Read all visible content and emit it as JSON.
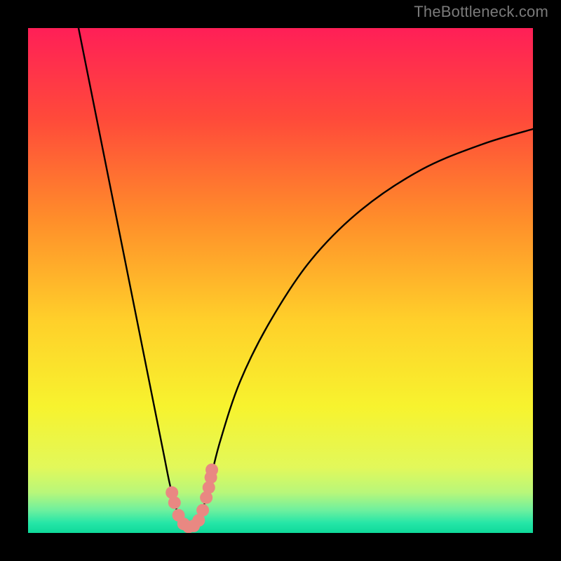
{
  "watermark": "TheBottleneck.com",
  "chart_data": {
    "type": "line",
    "title": "",
    "xlabel": "",
    "ylabel": "",
    "xlim": [
      0,
      100
    ],
    "ylim": [
      0,
      100
    ],
    "grid": false,
    "series": [
      {
        "name": "curve",
        "x": [
          10,
          14,
          18,
          20,
          22,
          24,
          25,
          26,
          27,
          28,
          29,
          30,
          31,
          32,
          33,
          34,
          35,
          36,
          38,
          42,
          48,
          56,
          66,
          78,
          90,
          100
        ],
        "values": [
          100,
          80,
          60,
          50,
          40,
          30,
          25,
          20,
          15,
          10,
          6,
          3,
          1.5,
          1,
          1.5,
          3,
          6,
          10,
          18,
          30,
          42,
          54,
          64,
          72,
          77,
          80
        ]
      }
    ],
    "markers": {
      "name": "highlight-points",
      "color": "#e98882",
      "x": [
        28.5,
        29,
        29.8,
        30.8,
        31.8,
        32.8,
        33.8,
        34.6,
        35.3,
        35.8,
        36.2,
        36.4
      ],
      "values": [
        8,
        6,
        3.5,
        1.8,
        1.2,
        1.4,
        2.5,
        4.5,
        7,
        9,
        11,
        12.5
      ]
    },
    "background_gradient": {
      "stops": [
        {
          "t": 0.0,
          "color": "#ff1f57"
        },
        {
          "t": 0.18,
          "color": "#ff4a3a"
        },
        {
          "t": 0.38,
          "color": "#ff8e2a"
        },
        {
          "t": 0.58,
          "color": "#ffd02a"
        },
        {
          "t": 0.75,
          "color": "#f7f32e"
        },
        {
          "t": 0.87,
          "color": "#e2f85a"
        },
        {
          "t": 0.92,
          "color": "#b8f77a"
        },
        {
          "t": 0.955,
          "color": "#6ef09e"
        },
        {
          "t": 0.98,
          "color": "#25e6a7"
        },
        {
          "t": 1.0,
          "color": "#0fd99a"
        }
      ]
    }
  }
}
